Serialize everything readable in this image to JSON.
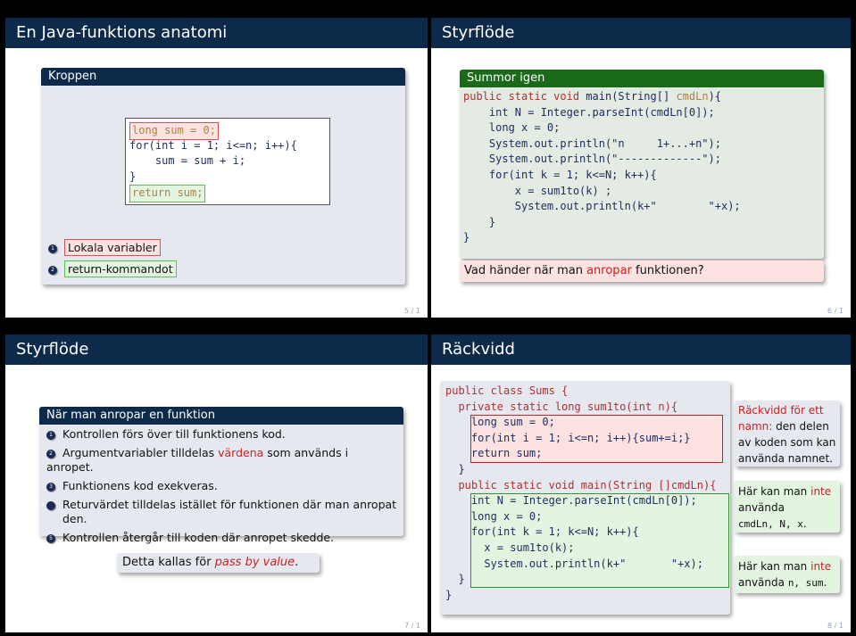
{
  "slides": [
    {
      "title": "En Java-funktions anatomi",
      "page": "5 / 1",
      "block_title": "Kroppen",
      "code": {
        "line1": "long sum = 0;",
        "line2": "for(int i = 1; i<=n; i++){",
        "line3": "    sum = sum + i;",
        "line4": "}",
        "line5": "return sum;"
      },
      "items": [
        {
          "num": "1",
          "label": "Lokala variabler"
        },
        {
          "num": "2",
          "label": "return-kommandot"
        }
      ]
    },
    {
      "title": "Styrflöde",
      "page": "6 / 1",
      "block_title": "Summor igen",
      "code": [
        {
          "pre": "",
          "kw": "public static void ",
          "fn": "main",
          "mid": "(String[] ",
          "kw2": "cmdLn",
          "post": "){"
        },
        {
          "text": "    int N = Integer.parseInt(cmdLn[0]);"
        },
        {
          "text": "    long x = 0;"
        },
        {
          "text": "    System.out.println(\"n     1+...+n\");"
        },
        {
          "text": "    System.out.println(\"-------------\");"
        },
        {
          "text": "    for(int k = 1; k<=N; k++){"
        },
        {
          "text": "        x = sum1to(k) ;"
        },
        {
          "text": "        System.out.println(k+\"        \"+x);"
        },
        {
          "text": "    }"
        },
        {
          "text": "}"
        }
      ],
      "question_pre": "Vad händer när man ",
      "question_hl": "anropar",
      "question_post": " funktionen?"
    },
    {
      "title": "Styrflöde",
      "page": "7 / 1",
      "block_title": "När man anropar en funktion",
      "items": [
        {
          "num": "1",
          "pre": "Kontrollen förs över till funktionens kod.",
          "hl": "",
          "post": ""
        },
        {
          "num": "2",
          "pre": "Argumentvariabler tilldelas ",
          "hl": "värdena",
          "post": " som används i anropet."
        },
        {
          "num": "3",
          "pre": "Funktionens kod exekveras.",
          "hl": "",
          "post": ""
        },
        {
          "num": "4",
          "pre": "Returvärdet tilldelas istället för funktionen där man anropat den.",
          "hl": "",
          "post": ""
        },
        {
          "num": "5",
          "pre": "Kontrollen återgår till koden där anropet skedde.",
          "hl": "",
          "post": ""
        }
      ],
      "note_pre": "Detta kallas för ",
      "note_hl": "pass by value",
      "note_post": "."
    },
    {
      "title": "Räckvidd",
      "page": "8 / 1",
      "code": {
        "l1": "public class Sums {",
        "l2": "  private static long sum1to(int n){",
        "l3": "    long sum = 0;",
        "l4": "    for(int i = 1; i<=n; i++){sum+=i;}",
        "l5": "    return sum;",
        "l6": "  }",
        "l7": "  public static void main(String []cmdLn){",
        "l8": "    int N = Integer.parseInt(cmdLn[0]);",
        "l9": "    long x = 0;",
        "l10": "    for(int k = 1; k<=N; k++){",
        "l11": "      x = sum1to(k);",
        "l12": "      System.out.println(k+\"       \"+x);",
        "l13": "  }",
        "l14": "}"
      },
      "note1_hl": "Räckvidd för ett namn:",
      "note1_rest": " den delen av koden som kan använda namnet.",
      "note2_pre": "Här kan man ",
      "note2_hl": "inte",
      "note2_post": " använda ",
      "note2_code": "cmdLn, N, x",
      "note2_end": ".",
      "note3_pre": "Här kan man ",
      "note3_hl": "inte",
      "note3_post": " använda ",
      "note3_code": "n, sum",
      "note3_end": "."
    }
  ],
  "colors": {
    "title_bar": "#0d2a4a",
    "block_blue": "#0d2a4a",
    "block_green": "#1a6a1a",
    "code_blue": "#1e2e60",
    "highlight_red": "#d02020",
    "highlight_green": "#2a9a2a"
  }
}
